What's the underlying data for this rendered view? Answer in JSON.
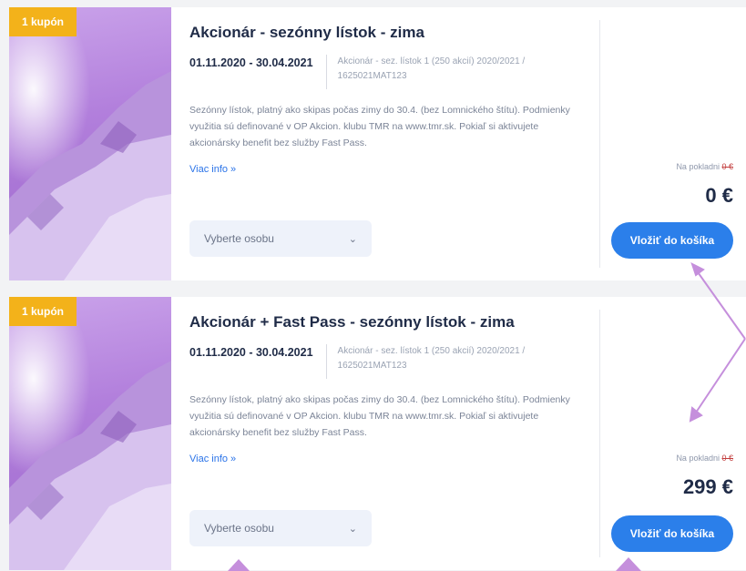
{
  "products": [
    {
      "badge": "1 kupón",
      "title": "Akcionár - sezónny lístok - zima",
      "dates": "01.11.2020 - 30.04.2021",
      "code": "Akcionár - sez. lístok 1 (250 akcií) 2020/2021 / 1625021MAT123",
      "description": "Sezónny lístok, platný ako skipas počas zimy do 30.4. (bez Lomnického štítu). Podmienky využitia sú definované v OP Akcion. klubu TMR na www.tmr.sk. Pokiaľ si aktivujete akcionársky benefit bez služby Fast Pass.",
      "more": "Viac info »",
      "select_placeholder": "Vyberte osobu",
      "price_note": "Na pokladni",
      "price_note_old": "0 €",
      "price": "0 €",
      "cart_label": "Vložiť do košíka"
    },
    {
      "badge": "1 kupón",
      "title": "Akcionár + Fast Pass - sezónny lístok - zima",
      "dates": "01.11.2020 - 30.04.2021",
      "code": "Akcionár - sez. lístok 1 (250 akcií) 2020/2021 / 1625021MAT123",
      "description": "Sezónny lístok, platný ako skipas počas zimy do 30.4. (bez Lomnického štítu). Podmienky využitia sú definované v OP Akcion. klubu TMR na www.tmr.sk. Pokiaľ si aktivujete akcionársky benefit bez služby Fast Pass.",
      "more": "Viac info »",
      "select_placeholder": "Vyberte osobu",
      "price_note": "Na pokladni",
      "price_note_old": "0 €",
      "price": "299 €",
      "cart_label": "Vložiť do košíka"
    }
  ],
  "colors": {
    "badge": "#f3b21a",
    "accent": "#2b7fea",
    "arrow": "#c58fdc"
  }
}
